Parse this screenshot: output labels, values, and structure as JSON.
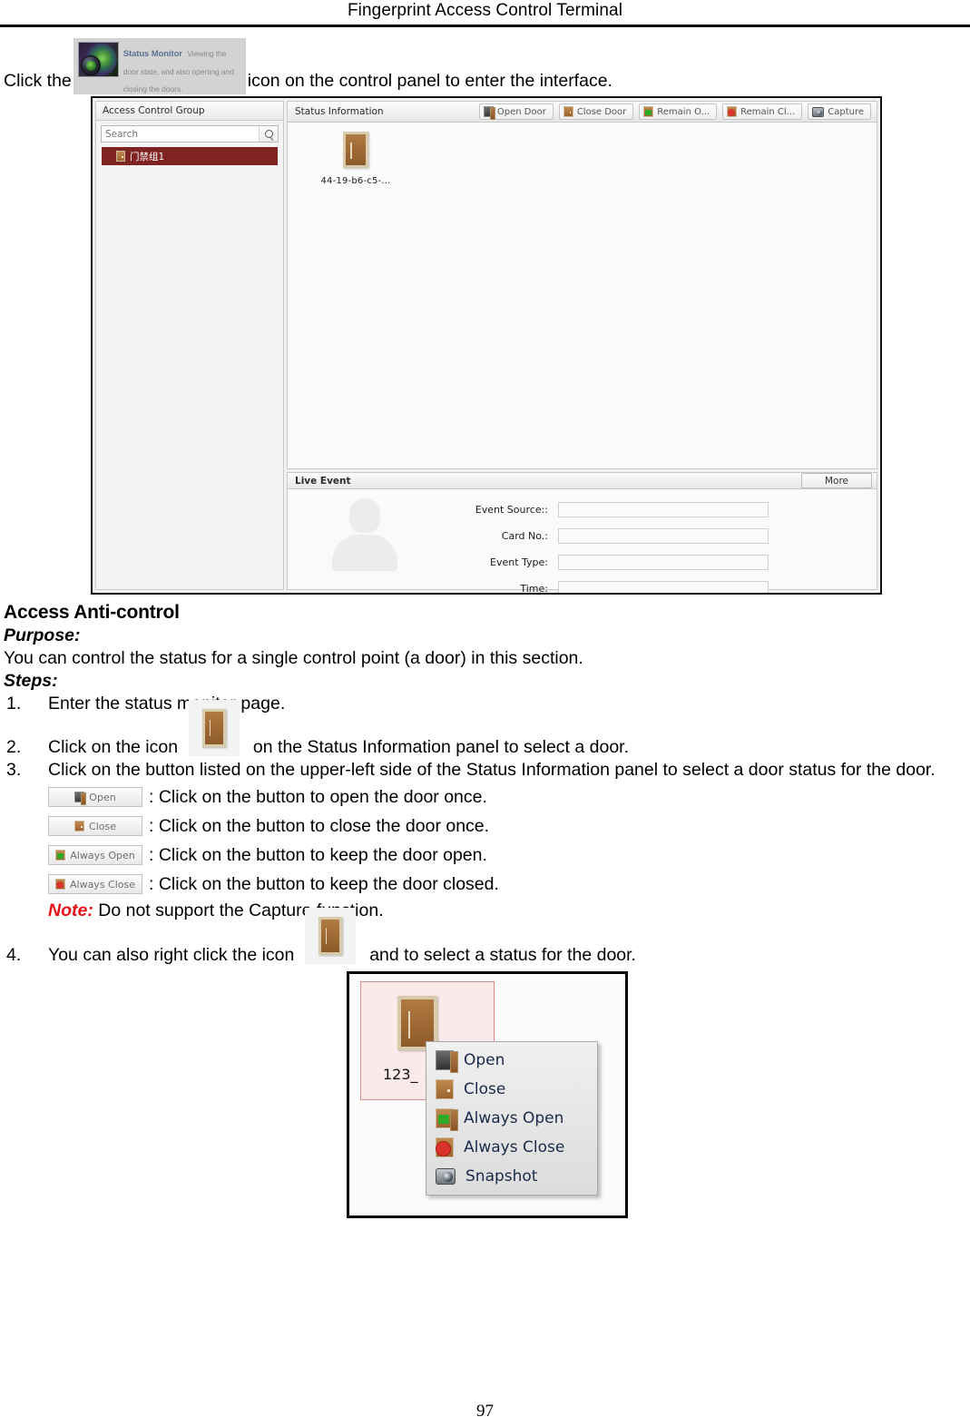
{
  "header": {
    "title": "Fingerprint Access Control Terminal"
  },
  "intro": {
    "before": "Click the",
    "after": "icon on the control panel to enter the interface.",
    "tile": {
      "title": "Status Monitor",
      "description": "Viewing the door state, and also opening and closing the doors."
    }
  },
  "screenshot": {
    "left_panel": {
      "title": "Access Control Group",
      "search_placeholder": "Search",
      "tree_items": [
        {
          "label": "门禁组1"
        }
      ]
    },
    "status_information": {
      "title": "Status Information",
      "toolbar": [
        {
          "label": "Open Door",
          "icon": "door-open-icon"
        },
        {
          "label": "Close Door",
          "icon": "door-closed-icon"
        },
        {
          "label": "Remain O...",
          "icon": "door-remain-open-icon"
        },
        {
          "label": "Remain Cl...",
          "icon": "door-remain-closed-icon"
        },
        {
          "label": "Capture",
          "icon": "camera-icon"
        }
      ],
      "doors": [
        {
          "label": "44-19-b6-c5-..."
        }
      ]
    },
    "live_event": {
      "title": "Live Event",
      "more_label": "More",
      "fields": [
        {
          "label": "Event Source::",
          "value": ""
        },
        {
          "label": "Card No.:",
          "value": ""
        },
        {
          "label": "Event Type:",
          "value": ""
        },
        {
          "label": "Time:",
          "value": ""
        }
      ]
    }
  },
  "section": {
    "title": "Access Anti-control",
    "purpose_label": "Purpose:",
    "purpose_text": "You can control the status for a single control point (a door) in this section.",
    "steps_label": "Steps:"
  },
  "steps": [
    {
      "num": "1.",
      "text": "Enter the status monitor page."
    },
    {
      "num": "2.",
      "text_before": "Click on the icon",
      "text_after": "on the Status Information panel to select a door."
    },
    {
      "num": "3.",
      "text": "Click on the button listed on the upper-left side of the Status Information panel to select a door status for the door."
    },
    {
      "num": "4.",
      "text_before": "You can also right click the icon",
      "text_after": "and to select a status for the door."
    }
  ],
  "legend": [
    {
      "button": "Open",
      "icon": "door-open-icon",
      "description": ": Click on the button to open the door once."
    },
    {
      "button": "Close",
      "icon": "door-closed-icon",
      "description": ": Click on the button to close the door once."
    },
    {
      "button": "Always Open",
      "icon": "door-always-open-icon",
      "description": ": Click on the button to keep the door open."
    },
    {
      "button": "Always Close",
      "icon": "door-always-close-icon",
      "description": ": Click on the button to keep the door closed."
    }
  ],
  "note": {
    "keyword": "Note:",
    "text": "Do not support the Capture function."
  },
  "context_screenshot": {
    "selected_door_label": "123_",
    "menu_items": [
      {
        "label": "Open",
        "icon": "door-open-icon"
      },
      {
        "label": "Close",
        "icon": "door-closed-icon"
      },
      {
        "label": "Always Open",
        "icon": "door-always-open-icon"
      },
      {
        "label": "Always Close",
        "icon": "door-always-close-icon"
      },
      {
        "label": "Snapshot",
        "icon": "camera-icon"
      }
    ]
  },
  "footer": {
    "page_number": "97"
  }
}
